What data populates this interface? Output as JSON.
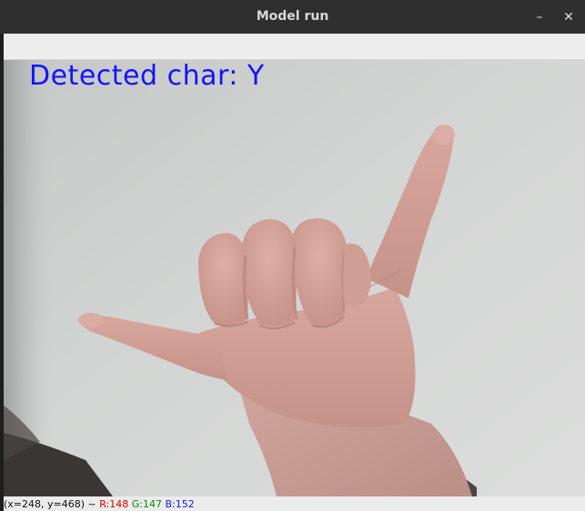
{
  "window": {
    "title": "Model run",
    "minimize_glyph": "–",
    "close_glyph": "✕"
  },
  "overlay": {
    "detected_text": "Detected char: Y",
    "text_color": "#1414ff"
  },
  "status": {
    "coords": "(x=248, y=468) ~",
    "r_label": "R:148",
    "g_label": "G:147",
    "b_label": "B:152"
  },
  "icons": {
    "minimize": "minimize-icon",
    "close": "close-icon"
  }
}
